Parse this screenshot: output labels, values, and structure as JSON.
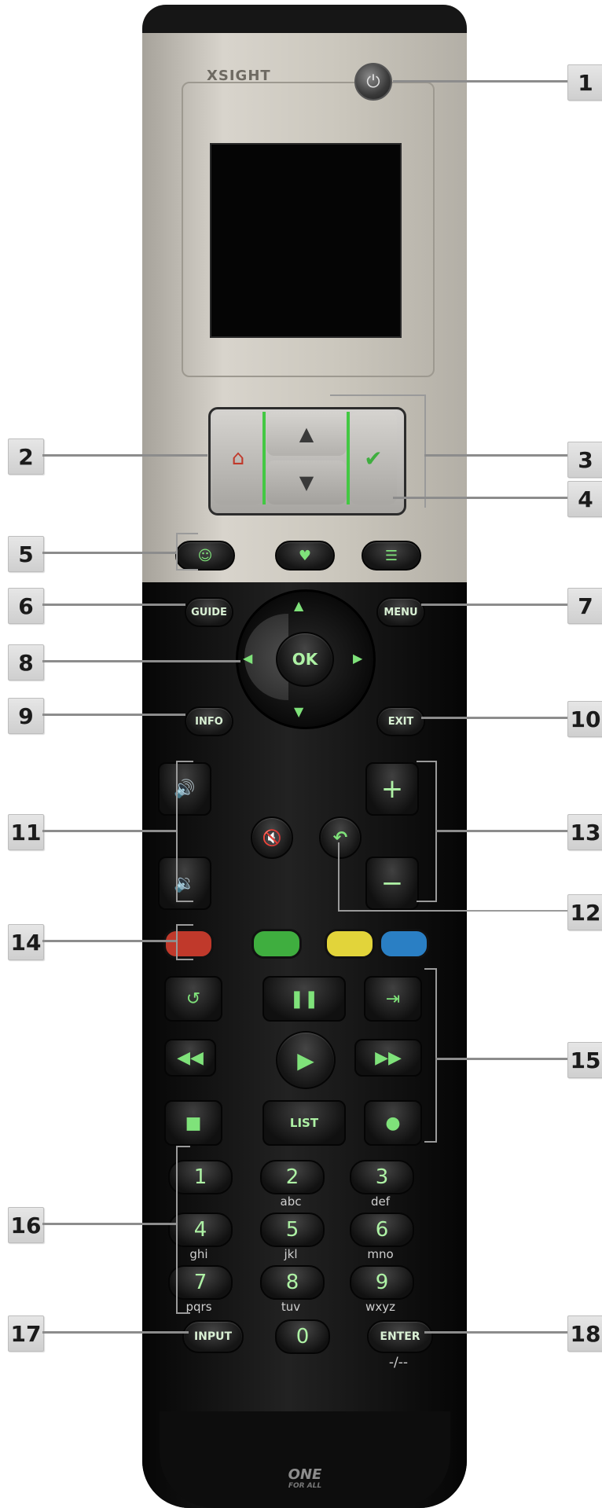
{
  "brand": {
    "logo_text": "XSIGHT",
    "footer_logo": "ONE",
    "footer_sub": "FOR ALL"
  },
  "callouts": [
    "1",
    "2",
    "3",
    "4",
    "5",
    "6",
    "7",
    "8",
    "9",
    "10",
    "11",
    "12",
    "13",
    "14",
    "15",
    "16",
    "17",
    "18"
  ],
  "buttons": {
    "guide": "GUIDE",
    "menu": "MENU",
    "ok": "OK",
    "info": "INFO",
    "exit": "EXIT",
    "list": "LIST",
    "input": "INPUT",
    "enter": "ENTER",
    "dash": "-/--"
  },
  "keypad": [
    {
      "digit": "1",
      "letters": ""
    },
    {
      "digit": "2",
      "letters": "abc"
    },
    {
      "digit": "3",
      "letters": "def"
    },
    {
      "digit": "4",
      "letters": "ghi"
    },
    {
      "digit": "5",
      "letters": "jkl"
    },
    {
      "digit": "6",
      "letters": "mno"
    },
    {
      "digit": "7",
      "letters": "pqrs"
    },
    {
      "digit": "8",
      "letters": "tuv"
    },
    {
      "digit": "9",
      "letters": "wxyz"
    },
    {
      "digit": "0",
      "letters": ""
    }
  ],
  "colors": {
    "red": "#c0392b",
    "green": "#3fae3f",
    "yellow": "#e2d43a",
    "blue": "#2a7fc4",
    "accent_glow": "#7fe27a"
  },
  "icons": {
    "power": "power-icon",
    "home": "home-icon",
    "check": "check-icon",
    "up": "arrow-up-icon",
    "down": "arrow-down-icon",
    "activity": "activity-icon",
    "favorite": "heart-icon",
    "list_icon": "list-icon",
    "volume_up": "volume-up-icon",
    "volume_down": "volume-down-icon",
    "mute": "mute-icon",
    "back": "back-icon",
    "replay": "replay-icon",
    "pause": "pause-icon",
    "skip": "skip-icon",
    "rewind": "rewind-icon",
    "play": "play-icon",
    "fast_forward": "fast-forward-icon",
    "stop": "stop-icon",
    "record": "record-icon"
  }
}
